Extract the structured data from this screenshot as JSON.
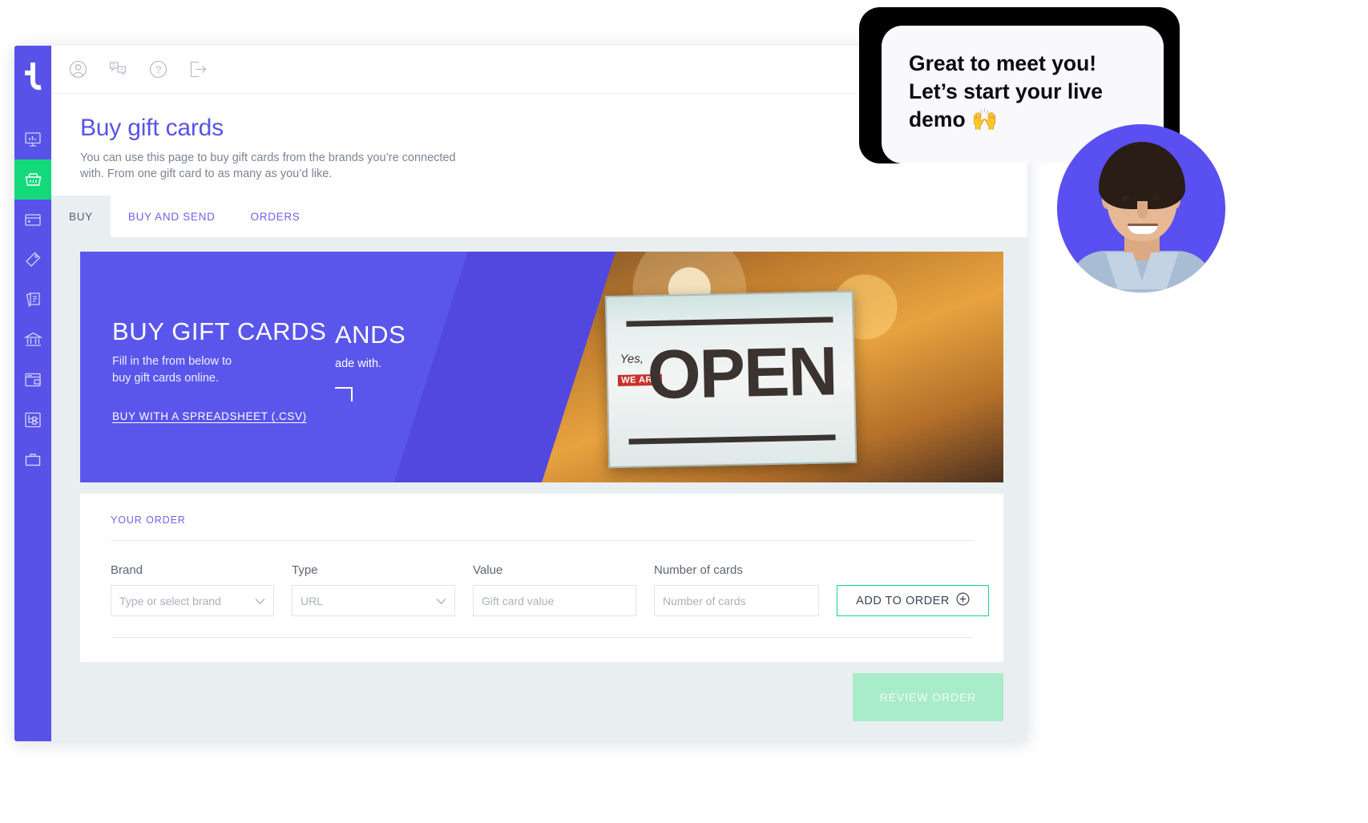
{
  "colors": {
    "brand_purple": "#5952e8",
    "accent_green": "#14d97b",
    "panel_grey": "#e9eef1",
    "text_grey": "#7c8493"
  },
  "sidebar": {
    "logo_name": "tillo-logo",
    "items": [
      {
        "icon": "dashboard-monitor-icon",
        "label": "Dashboard",
        "active": false
      },
      {
        "icon": "shopping-basket-icon",
        "label": "Buy gift cards",
        "active": true
      },
      {
        "icon": "card-icon",
        "label": "Cards",
        "active": false
      },
      {
        "icon": "price-tag-icon",
        "label": "Offers",
        "active": false
      },
      {
        "icon": "documents-icon",
        "label": "Reports",
        "active": false
      },
      {
        "icon": "bank-icon",
        "label": "Finance",
        "active": false
      },
      {
        "icon": "browser-window-icon",
        "label": "Storefront",
        "active": false
      },
      {
        "icon": "sitemap-icon",
        "label": "Integrations",
        "active": false
      },
      {
        "icon": "briefcase-icon",
        "label": "Account",
        "active": false
      }
    ]
  },
  "topbar": {
    "icons": [
      {
        "name": "user-account-icon",
        "label": "Account"
      },
      {
        "name": "translate-chat-icon",
        "label": "Language"
      },
      {
        "name": "help-question-icon",
        "label": "Help"
      },
      {
        "name": "logout-icon",
        "label": "Log out"
      }
    ]
  },
  "page": {
    "title": "Buy gift cards",
    "subtitle": "You can use this page to buy gift cards from the brands you’re connected with. From one gift card to as many as you’d like."
  },
  "tabs": [
    {
      "label": "BUY",
      "active": true
    },
    {
      "label": "BUY AND SEND",
      "active": false
    },
    {
      "label": "ORDERS",
      "active": false
    }
  ],
  "hero": {
    "current_slide": {
      "title": "BUY GIFT CARDS",
      "subtitle_line1": "Fill in the from below to",
      "subtitle_line2": "buy gift cards online.",
      "link": "BUY WITH A SPREADSHEET (.CSV)"
    },
    "previous_slide": {
      "title_visible": "ANDS",
      "subtitle_visible": "ade with."
    },
    "photo_alt": "open-sign-in-shop-window",
    "sign_text": "OPEN",
    "sign_small_top": "Yes,",
    "sign_small_badge": "WE ARE"
  },
  "order": {
    "section_title": "YOUR ORDER",
    "fields": [
      {
        "label": "Brand",
        "placeholder": "Type or select brand",
        "type": "select",
        "value": ""
      },
      {
        "label": "Type",
        "placeholder": "URL",
        "type": "select",
        "value": ""
      },
      {
        "label": "Value",
        "placeholder": "Gift card value",
        "type": "text",
        "value": ""
      },
      {
        "label": "Number of cards",
        "placeholder": "Number of cards",
        "type": "text",
        "value": ""
      }
    ],
    "add_button": "ADD TO ORDER",
    "add_button_icon": "plus-circle-icon",
    "review_button": "REVIEW ORDER"
  },
  "chat": {
    "message": "Great to meet you! Let’s start your live demo 🙌",
    "avatar_alt": "smiling-man-agent-photo"
  }
}
